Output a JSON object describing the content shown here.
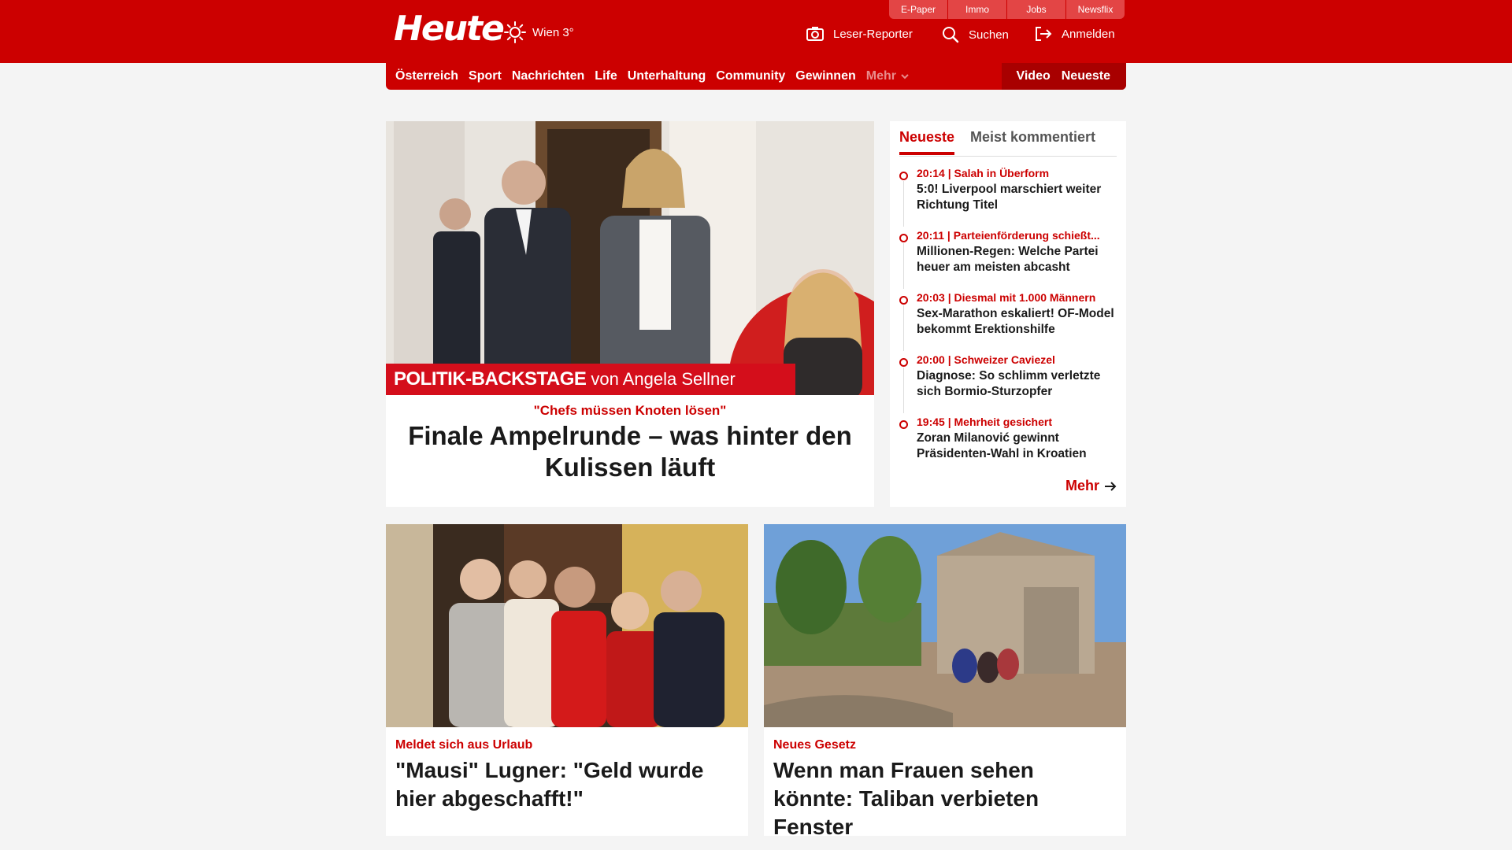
{
  "header": {
    "logo": "Heute",
    "weather": "Wien 3°",
    "util_links": [
      "E-Paper",
      "Immo",
      "Jobs",
      "Newsflix"
    ],
    "reporter": "Leser-Reporter",
    "search": "Suchen",
    "login": "Anmelden"
  },
  "nav": {
    "items": [
      "Österreich",
      "Sport",
      "Nachrichten",
      "Life",
      "Unterhaltung",
      "Community",
      "Gewinnen"
    ],
    "more": "Mehr",
    "video": "Video",
    "neueste": "Neueste"
  },
  "hero": {
    "banner_bold": "POLITIK-BACKSTAGE",
    "banner_rest": "von Angela Sellner",
    "kicker": "\"Chefs müssen Knoten lösen\"",
    "title": "Finale Ampelrunde – was hinter den Kulissen läuft"
  },
  "sidebar": {
    "tab_active": "Neueste",
    "tab_other": "Meist kommentiert",
    "items": [
      {
        "meta": "20:14 | Salah in Überform",
        "title": "5:0! Liverpool marschiert weiter Richtung Titel"
      },
      {
        "meta": "20:11 | Parteienförderung schießt...",
        "title": "Millionen-Regen: Welche Partei heuer am meisten abcasht"
      },
      {
        "meta": "20:03 | Diesmal mit 1.000 Männern",
        "title": "Sex-Marathon eskaliert! OF-Model bekommt Erektionshilfe"
      },
      {
        "meta": "20:00 | Schweizer Caviezel",
        "title": "Diagnose: So schlimm verletzte sich Bormio-Sturzopfer"
      },
      {
        "meta": "19:45 | Mehrheit gesichert",
        "title": "Zoran Milanović gewinnt Präsidenten-Wahl in Kroatien"
      }
    ],
    "more": "Mehr"
  },
  "cards": [
    {
      "kicker": "Meldet sich aus Urlaub",
      "title": "\"Mausi\" Lugner: \"Geld wurde hier abgeschafft!\""
    },
    {
      "kicker": "Neues Gesetz",
      "title": "Wenn man Frauen sehen könnte: Taliban verbieten Fenster"
    }
  ],
  "colors": {
    "brand_red": "#cc0000",
    "background": "#f4f4f4"
  }
}
